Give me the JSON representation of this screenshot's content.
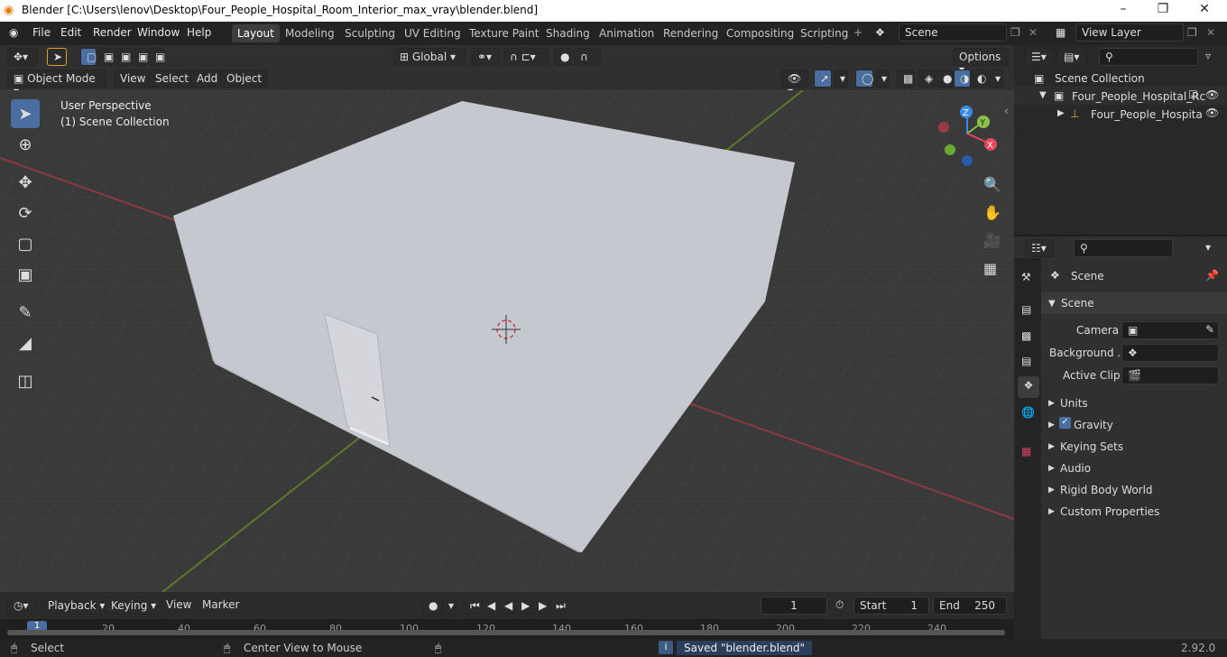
{
  "window": {
    "title": "Blender [C:\\Users\\lenov\\Desktop\\Four_People_Hospital_Room_Interior_max_vray\\blender.blend]",
    "controls": [
      "–",
      "❐",
      "✕"
    ]
  },
  "menu": {
    "file": "File",
    "edit": "Edit",
    "render": "Render",
    "window": "Window",
    "help": "Help"
  },
  "workspaces": [
    "Layout",
    "Modeling",
    "Sculpting",
    "UV Editing",
    "Texture Paint",
    "Shading",
    "Animation",
    "Rendering",
    "Compositing",
    "Scripting"
  ],
  "scene_field": "Scene",
  "view_layer_field": "View Layer",
  "header": {
    "transform": "Global",
    "options": "Options",
    "mode": "Object Mode",
    "view": "View",
    "select": "Select",
    "add": "Add",
    "object": "Object"
  },
  "viewport": {
    "perspective": "User Perspective",
    "collection": "(1) Scene Collection",
    "gizmo": {
      "x": "X",
      "y": "Y",
      "z": "Z"
    }
  },
  "outliner": {
    "root": "Scene Collection",
    "collection": "Four_People_Hospital_Rc",
    "object": "Four_People_Hospita"
  },
  "properties": {
    "context": "Scene",
    "panel": "Scene",
    "camera_label": "Camera",
    "background_label": "Background ...",
    "active_clip_label": "Active Clip",
    "sections": [
      "Units",
      "Gravity",
      "Keying Sets",
      "Audio",
      "Rigid Body World",
      "Custom Properties"
    ]
  },
  "timeline": {
    "playback": "Playback",
    "keying": "Keying",
    "view": "View",
    "marker": "Marker",
    "current_frame": "1",
    "start_label": "Start",
    "start": "1",
    "end_label": "End",
    "end": "250",
    "ticks": [
      "1",
      "20",
      "40",
      "60",
      "80",
      "100",
      "120",
      "140",
      "160",
      "180",
      "200",
      "220",
      "240"
    ]
  },
  "status": {
    "select": "Select",
    "center_view": "Center View to Mouse",
    "saved": "Saved \"blender.blend\"",
    "version": "2.92.0"
  },
  "colors": {
    "accent": "#4a6ea0",
    "x_axis": "#e24a5a",
    "y_axis": "#8bc34a",
    "z_axis": "#3a8bf0",
    "room": "#c6c8cf"
  }
}
